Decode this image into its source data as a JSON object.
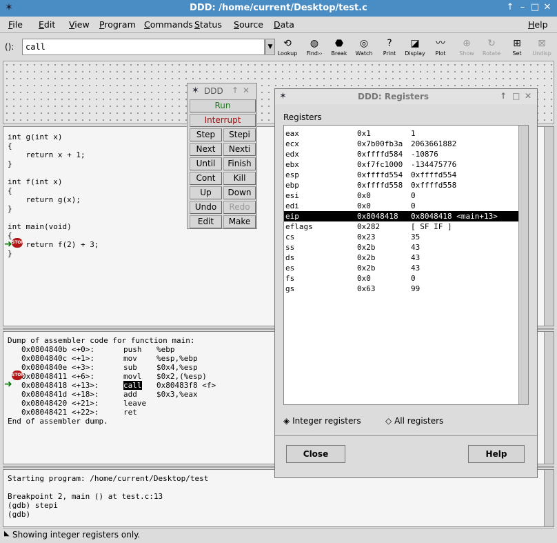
{
  "window": {
    "title": "DDD: /home/current/Desktop/test.c"
  },
  "menu": [
    "File",
    "Edit",
    "View",
    "Program",
    "Commands",
    "Status",
    "Source",
    "Data",
    "Help"
  ],
  "toolbar": {
    "arg_label": "():",
    "arg_value": "call",
    "tools": [
      {
        "label": "Lookup",
        "icon": "lookup-icon",
        "glyph": "⟲",
        "enabled": true
      },
      {
        "label": "Find››",
        "icon": "binoculars-icon",
        "glyph": "◍",
        "enabled": true
      },
      {
        "label": "Break",
        "icon": "stop-icon",
        "glyph": "⬣",
        "enabled": true
      },
      {
        "label": "Watch",
        "icon": "glasses-icon",
        "glyph": "◎",
        "enabled": true
      },
      {
        "label": "Print",
        "icon": "question-icon",
        "glyph": "?",
        "enabled": true
      },
      {
        "label": "Display",
        "icon": "display-icon",
        "glyph": "◪",
        "enabled": true
      },
      {
        "label": "Plot",
        "icon": "plot-icon",
        "glyph": "〰",
        "enabled": true
      },
      {
        "label": "Show",
        "icon": "magnifier-icon",
        "glyph": "⊕",
        "enabled": false
      },
      {
        "label": "Rotate",
        "icon": "rotate-icon",
        "glyph": "↻",
        "enabled": false
      },
      {
        "label": "Set",
        "icon": "set-icon",
        "glyph": "⊞",
        "enabled": true
      },
      {
        "label": "Undisp",
        "icon": "undisp-icon",
        "glyph": "⊠",
        "enabled": false
      }
    ]
  },
  "source": {
    "lines": [
      "int g(int x)",
      "{",
      "    return x + 1;",
      "}",
      "",
      "int f(int x)",
      "{",
      "    return g(x);",
      "}",
      "",
      "int main(void)",
      "{",
      "    return f(2) + 3;",
      "}"
    ]
  },
  "asm": {
    "header": "Dump of assembler code for function main:",
    "rows": [
      {
        "addr": "0x0804840b <+0>:",
        "op": "push",
        "args": "%ebp"
      },
      {
        "addr": "0x0804840c <+1>:",
        "op": "mov",
        "args": "%esp,%ebp"
      },
      {
        "addr": "0x0804840e <+3>:",
        "op": "sub",
        "args": "$0x4,%esp"
      },
      {
        "addr": "0x08048411 <+6>:",
        "op": "movl",
        "args": "$0x2,(%esp)"
      },
      {
        "addr": "0x08048418 <+13>:",
        "op": "call",
        "args": "0x80483f8 <f>"
      },
      {
        "addr": "0x0804841d <+18>:",
        "op": "add",
        "args": "$0x3,%eax"
      },
      {
        "addr": "0x08048420 <+21>:",
        "op": "leave",
        "args": ""
      },
      {
        "addr": "0x08048421 <+22>:",
        "op": "ret",
        "args": ""
      }
    ],
    "footer": "End of assembler dump."
  },
  "console": {
    "lines": [
      "Starting program: /home/current/Desktop/test",
      "",
      "Breakpoint 2, main () at test.c:13",
      "(gdb) stepi",
      "(gdb) "
    ]
  },
  "status": "Showing integer registers only.",
  "cmdtool": {
    "title": "DDD",
    "run": "Run",
    "interrupt": "Interrupt",
    "pairs": [
      [
        "Step",
        "Stepi"
      ],
      [
        "Next",
        "Nexti"
      ],
      [
        "Until",
        "Finish"
      ],
      [
        "Cont",
        "Kill"
      ],
      [
        "Up",
        "Down"
      ],
      [
        "Undo",
        "Redo"
      ],
      [
        "Edit",
        "Make"
      ]
    ]
  },
  "registers": {
    "title": "DDD: Registers",
    "label": "Registers",
    "rows": [
      {
        "name": "eax",
        "hex": "0x1",
        "val": "1"
      },
      {
        "name": "ecx",
        "hex": "0x7b00fb3a",
        "val": "2063661882"
      },
      {
        "name": "edx",
        "hex": "0xffffd584",
        "val": "-10876"
      },
      {
        "name": "ebx",
        "hex": "0xf7fc1000",
        "val": "-134475776"
      },
      {
        "name": "esp",
        "hex": "0xffffd554",
        "val": "0xffffd554"
      },
      {
        "name": "ebp",
        "hex": "0xffffd558",
        "val": "0xffffd558"
      },
      {
        "name": "esi",
        "hex": "0x0",
        "val": "0"
      },
      {
        "name": "edi",
        "hex": "0x0",
        "val": "0"
      },
      {
        "name": "eip",
        "hex": "0x8048418",
        "val": "0x8048418 <main+13>"
      },
      {
        "name": "eflags",
        "hex": "0x282",
        "val": "[ SF IF ]"
      },
      {
        "name": "cs",
        "hex": "0x23",
        "val": "35"
      },
      {
        "name": "ss",
        "hex": "0x2b",
        "val": "43"
      },
      {
        "name": "ds",
        "hex": "0x2b",
        "val": "43"
      },
      {
        "name": "es",
        "hex": "0x2b",
        "val": "43"
      },
      {
        "name": "fs",
        "hex": "0x0",
        "val": "0"
      },
      {
        "name": "gs",
        "hex": "0x63",
        "val": "99"
      }
    ],
    "selected": "eip",
    "integer_label": "Integer registers",
    "all_label": "All registers",
    "close": "Close",
    "help": "Help"
  }
}
